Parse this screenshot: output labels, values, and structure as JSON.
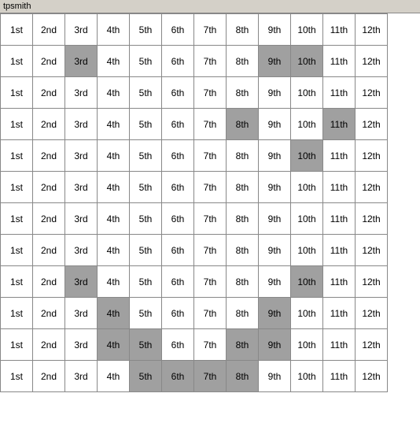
{
  "title": "tpsmith",
  "cols": [
    "1st",
    "2nd",
    "3rd",
    "4th",
    "5th",
    "6th",
    "7th",
    "8th",
    "9th",
    "10th",
    "11th",
    "12th"
  ],
  "rows": [
    [
      {
        "v": "1st",
        "h": ""
      },
      {
        "v": "2nd",
        "h": ""
      },
      {
        "v": "3rd",
        "h": ""
      },
      {
        "v": "4th",
        "h": ""
      },
      {
        "v": "5th",
        "h": ""
      },
      {
        "v": "6th",
        "h": ""
      },
      {
        "v": "7th",
        "h": ""
      },
      {
        "v": "8th",
        "h": ""
      },
      {
        "v": "9th",
        "h": ""
      },
      {
        "v": "10th",
        "h": ""
      },
      {
        "v": "11th",
        "h": ""
      },
      {
        "v": "12th",
        "h": ""
      }
    ],
    [
      {
        "v": "1st",
        "h": ""
      },
      {
        "v": "2nd",
        "h": ""
      },
      {
        "v": "3rd",
        "h": "gray"
      },
      {
        "v": "4th",
        "h": ""
      },
      {
        "v": "5th",
        "h": ""
      },
      {
        "v": "6th",
        "h": ""
      },
      {
        "v": "7th",
        "h": ""
      },
      {
        "v": "8th",
        "h": ""
      },
      {
        "v": "9th",
        "h": "gray"
      },
      {
        "v": "10th",
        "h": "gray"
      },
      {
        "v": "11th",
        "h": ""
      },
      {
        "v": "12th",
        "h": ""
      }
    ],
    [
      {
        "v": "1st",
        "h": ""
      },
      {
        "v": "2nd",
        "h": ""
      },
      {
        "v": "3rd",
        "h": ""
      },
      {
        "v": "4th",
        "h": ""
      },
      {
        "v": "5th",
        "h": ""
      },
      {
        "v": "6th",
        "h": ""
      },
      {
        "v": "7th",
        "h": ""
      },
      {
        "v": "8th",
        "h": ""
      },
      {
        "v": "9th",
        "h": ""
      },
      {
        "v": "10th",
        "h": ""
      },
      {
        "v": "11th",
        "h": ""
      },
      {
        "v": "12th",
        "h": ""
      }
    ],
    [
      {
        "v": "1st",
        "h": ""
      },
      {
        "v": "2nd",
        "h": ""
      },
      {
        "v": "3rd",
        "h": ""
      },
      {
        "v": "4th",
        "h": ""
      },
      {
        "v": "5th",
        "h": ""
      },
      {
        "v": "6th",
        "h": ""
      },
      {
        "v": "7th",
        "h": ""
      },
      {
        "v": "8th",
        "h": "gray"
      },
      {
        "v": "9th",
        "h": ""
      },
      {
        "v": "10th",
        "h": ""
      },
      {
        "v": "11th",
        "h": "gray"
      },
      {
        "v": "12th",
        "h": ""
      }
    ],
    [
      {
        "v": "1st",
        "h": ""
      },
      {
        "v": "2nd",
        "h": ""
      },
      {
        "v": "3rd",
        "h": ""
      },
      {
        "v": "4th",
        "h": ""
      },
      {
        "v": "5th",
        "h": ""
      },
      {
        "v": "6th",
        "h": ""
      },
      {
        "v": "7th",
        "h": ""
      },
      {
        "v": "8th",
        "h": ""
      },
      {
        "v": "9th",
        "h": ""
      },
      {
        "v": "10th",
        "h": "gray"
      },
      {
        "v": "11th",
        "h": ""
      },
      {
        "v": "12th",
        "h": ""
      }
    ],
    [
      {
        "v": "1st",
        "h": ""
      },
      {
        "v": "2nd",
        "h": ""
      },
      {
        "v": "3rd",
        "h": ""
      },
      {
        "v": "4th",
        "h": ""
      },
      {
        "v": "5th",
        "h": ""
      },
      {
        "v": "6th",
        "h": ""
      },
      {
        "v": "7th",
        "h": ""
      },
      {
        "v": "8th",
        "h": ""
      },
      {
        "v": "9th",
        "h": ""
      },
      {
        "v": "10th",
        "h": ""
      },
      {
        "v": "11th",
        "h": ""
      },
      {
        "v": "12th",
        "h": ""
      }
    ],
    [
      {
        "v": "1st",
        "h": ""
      },
      {
        "v": "2nd",
        "h": ""
      },
      {
        "v": "3rd",
        "h": ""
      },
      {
        "v": "4th",
        "h": ""
      },
      {
        "v": "5th",
        "h": ""
      },
      {
        "v": "6th",
        "h": ""
      },
      {
        "v": "7th",
        "h": ""
      },
      {
        "v": "8th",
        "h": ""
      },
      {
        "v": "9th",
        "h": ""
      },
      {
        "v": "10th",
        "h": ""
      },
      {
        "v": "11th",
        "h": ""
      },
      {
        "v": "12th",
        "h": ""
      }
    ],
    [
      {
        "v": "1st",
        "h": ""
      },
      {
        "v": "2nd",
        "h": ""
      },
      {
        "v": "3rd",
        "h": ""
      },
      {
        "v": "4th",
        "h": ""
      },
      {
        "v": "5th",
        "h": ""
      },
      {
        "v": "6th",
        "h": ""
      },
      {
        "v": "7th",
        "h": ""
      },
      {
        "v": "8th",
        "h": ""
      },
      {
        "v": "9th",
        "h": ""
      },
      {
        "v": "10th",
        "h": ""
      },
      {
        "v": "11th",
        "h": ""
      },
      {
        "v": "12th",
        "h": ""
      }
    ],
    [
      {
        "v": "1st",
        "h": ""
      },
      {
        "v": "2nd",
        "h": ""
      },
      {
        "v": "3rd",
        "h": "gray"
      },
      {
        "v": "4th",
        "h": ""
      },
      {
        "v": "5th",
        "h": ""
      },
      {
        "v": "6th",
        "h": ""
      },
      {
        "v": "7th",
        "h": ""
      },
      {
        "v": "8th",
        "h": ""
      },
      {
        "v": "9th",
        "h": ""
      },
      {
        "v": "10th",
        "h": "gray"
      },
      {
        "v": "11th",
        "h": ""
      },
      {
        "v": "12th",
        "h": ""
      }
    ],
    [
      {
        "v": "1st",
        "h": ""
      },
      {
        "v": "2nd",
        "h": ""
      },
      {
        "v": "3rd",
        "h": ""
      },
      {
        "v": "4th",
        "h": "gray"
      },
      {
        "v": "5th",
        "h": ""
      },
      {
        "v": "6th",
        "h": ""
      },
      {
        "v": "7th",
        "h": ""
      },
      {
        "v": "8th",
        "h": ""
      },
      {
        "v": "9th",
        "h": "gray"
      },
      {
        "v": "10th",
        "h": ""
      },
      {
        "v": "11th",
        "h": ""
      },
      {
        "v": "12th",
        "h": ""
      }
    ],
    [
      {
        "v": "1st",
        "h": ""
      },
      {
        "v": "2nd",
        "h": ""
      },
      {
        "v": "3rd",
        "h": ""
      },
      {
        "v": "4th",
        "h": "gray"
      },
      {
        "v": "5th",
        "h": "gray"
      },
      {
        "v": "6th",
        "h": ""
      },
      {
        "v": "7th",
        "h": ""
      },
      {
        "v": "8th",
        "h": "gray"
      },
      {
        "v": "9th",
        "h": "gray"
      },
      {
        "v": "10th",
        "h": ""
      },
      {
        "v": "11th",
        "h": ""
      },
      {
        "v": "12th",
        "h": ""
      }
    ],
    [
      {
        "v": "1st",
        "h": ""
      },
      {
        "v": "2nd",
        "h": ""
      },
      {
        "v": "3rd",
        "h": ""
      },
      {
        "v": "4th",
        "h": ""
      },
      {
        "v": "5th",
        "h": "gray"
      },
      {
        "v": "6th",
        "h": "gray"
      },
      {
        "v": "7th",
        "h": "gray"
      },
      {
        "v": "8th",
        "h": "gray"
      },
      {
        "v": "9th",
        "h": ""
      },
      {
        "v": "10th",
        "h": ""
      },
      {
        "v": "11th",
        "h": ""
      },
      {
        "v": "12th",
        "h": ""
      }
    ]
  ]
}
